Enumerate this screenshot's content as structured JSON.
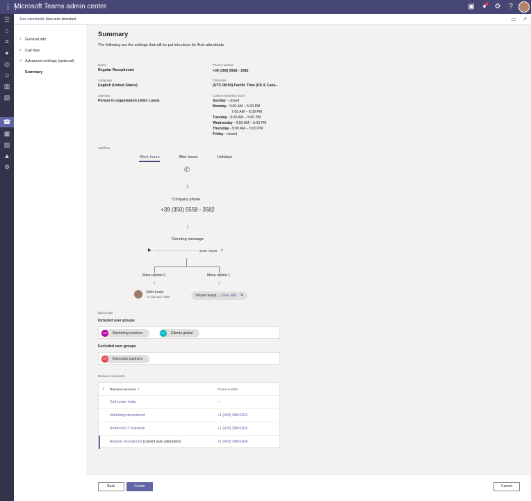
{
  "app": {
    "title": "Microsoft Teams admin center",
    "notification_count": "1"
  },
  "breadcrumb": {
    "parent": "Auto attendants",
    "separator": "\\",
    "current": "New auto attendant"
  },
  "wizard": {
    "steps": [
      {
        "label": "General info",
        "done": true
      },
      {
        "label": "Call flow",
        "done": true
      },
      {
        "label": "Advanced settings (optional)",
        "done": true
      },
      {
        "label": "Summary",
        "done": false
      }
    ]
  },
  "summary": {
    "title": "Summary",
    "subtitle": "The following are the settings that will be put into place for Auto attendants.",
    "fields": {
      "name_label": "Name",
      "name_value": "Regular Receptionist",
      "phone_label": "Phone number",
      "phone_value": "+39 (350) 5558 - 3582",
      "language_label": "Language",
      "language_value": "English (United States)",
      "timezone_label": "Timezone",
      "timezone_value": "(UTC-08:00) Pacific Time (US & Cana...",
      "operator_label": "Operator",
      "operator_value": "Person in organization (John Louis)",
      "hours_label": "Custom business hours"
    },
    "hours": [
      {
        "day": "Sunday",
        "text": " - closed"
      },
      {
        "day": "Monday",
        "text": " - 9:00 AM – 5:00 PM"
      },
      {
        "day": "",
        "text": "7:00 AM – 8:30 PM"
      },
      {
        "day": "Tuesday",
        "text": " - 9:00 AM – 5:00 PM"
      },
      {
        "day": "Wednesday",
        "text": " - 9:00 AM – 5:00 PM"
      },
      {
        "day": "Thursday",
        "text": " - 9:00 AM – 5:00 PM"
      },
      {
        "day": "Friday",
        "text": " - closed"
      }
    ]
  },
  "call_flow": {
    "label": "Call flow",
    "tabs": [
      "Work hours",
      "After hours",
      "Holidays"
    ],
    "active_tab": "Work hours",
    "company_phone_label": "Company phone",
    "company_phone": "+39 (350) 5558 - 3582",
    "greeting_label": "Greeting message",
    "audio_time": "00:00 / 00:20",
    "menu_options": [
      "Menu option 0",
      "Menu option 1"
    ],
    "person": {
      "name": "John Louis",
      "phone": "+1 425 312 7566"
    },
    "virtual_receptionist": {
      "text": "Virtual recept...",
      "link": "(View RA)"
    }
  },
  "dial_scope": {
    "label": "Dial scope",
    "included_title": "Included user groups",
    "included": [
      {
        "initials": "MM",
        "name": "Marketing mentors",
        "color": "#b4009e"
      },
      {
        "initials": "CG",
        "name": "Clients global",
        "color": "#00b7c3"
      }
    ],
    "excluded_title": "Excluded user groups",
    "excluded": [
      {
        "initials": "EP",
        "name": "Executive partners",
        "color": "#e74856"
      }
    ]
  },
  "resource_accounts": {
    "label": "Resource accounts",
    "columns": [
      "Resource account",
      "Phone number"
    ],
    "rows": [
      {
        "account": "Call center India",
        "extra": "",
        "phone": "--"
      },
      {
        "account": "Marketing department",
        "extra": "",
        "phone": "+1 (425) 288-6203"
      },
      {
        "account": "Redmond IT helpdesk",
        "extra": "",
        "phone": "+1 (425) 288-6204"
      },
      {
        "account": "Regular receptionist",
        "extra": " (current auto attendant)",
        "phone": "+1 (425) 288-6204"
      }
    ]
  },
  "footer": {
    "back": "Back",
    "create": "Create",
    "cancel": "Cancel"
  },
  "colors": {
    "accent": "#6264a7",
    "topbar": "#464775",
    "rail": "#33344a"
  }
}
